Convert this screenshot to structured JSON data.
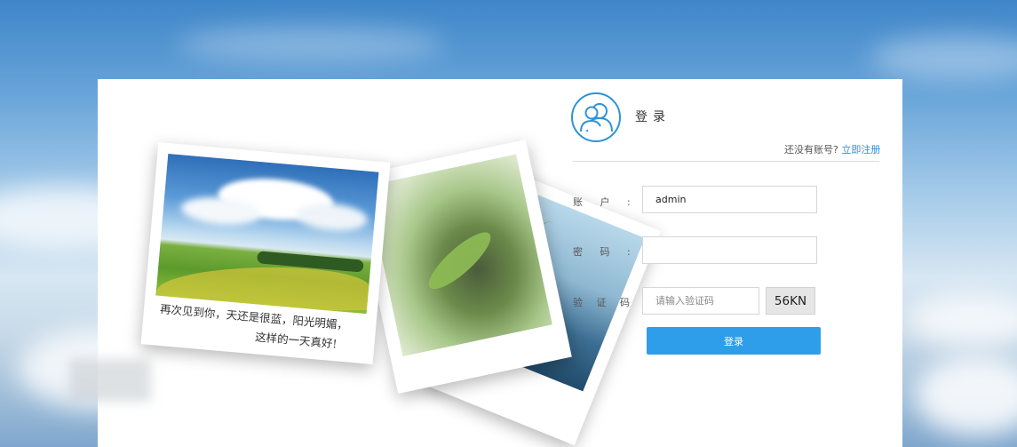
{
  "login": {
    "title": "登录",
    "register_prompt": "还没有账号?",
    "register_link": "立即注册",
    "account_label": "账 户 :",
    "account_value": "admin",
    "password_label": "密 码 :",
    "password_value": "",
    "captcha_label": "验 证 码 :",
    "captcha_placeholder": "请输入验证码",
    "captcha_code": "56KN",
    "submit_label": "登录"
  },
  "photo": {
    "caption_line1": "再次见到你，天还是很蓝，阳光明媚，",
    "caption_line2": "这样的一天真好!"
  },
  "icons": {
    "avatar": "users-icon"
  },
  "colors": {
    "accent": "#2f9eea",
    "link": "#2e8ee0"
  }
}
